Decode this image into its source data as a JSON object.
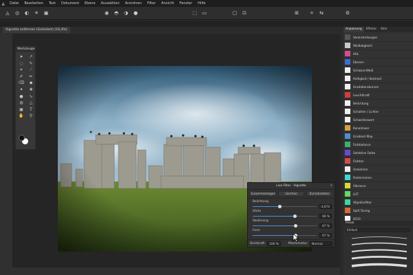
{
  "menu": [
    "Datei",
    "Bearbeiten",
    "Text",
    "Dokument",
    "Ebene",
    "Auswählen",
    "Anordnen",
    "Filter",
    "Ansicht",
    "Fenster",
    "Hilfe"
  ],
  "document": {
    "tab": "Vignette entfernen (Geändert) (16,4%)"
  },
  "tools": {
    "title": "Werkzeuge",
    "icons": [
      "move-tool-icon",
      "view-tool-icon",
      "lasso-icon",
      "crop-icon",
      "brush-icon",
      "picker-icon",
      "paint-icon",
      "erase-icon",
      "clone-icon",
      "healing-icon",
      "dodge-icon",
      "smudge-icon",
      "blur-icon",
      "sharpen-icon",
      "pen-icon",
      "shape-icon",
      "text-icon",
      "gradient-icon",
      "hand-icon",
      "zoom-icon"
    ]
  },
  "vignette": {
    "title": "Live-Filter - Vignette",
    "buttons": [
      "Zusammenlegen",
      "Löschen",
      "Zurücksetzen"
    ],
    "rows": [
      {
        "label": "Belichtung",
        "value": "-3,674",
        "pos": 0.43
      },
      {
        "label": "Härte",
        "value": "66 %",
        "pos": 0.66
      },
      {
        "label": "Skalierung",
        "value": "67 %",
        "pos": 0.67
      },
      {
        "label": "Form",
        "value": "67 %",
        "pos": 0.67
      }
    ],
    "opacity_label": "Deckkraft:",
    "opacity_value": "100 %",
    "blend_label": "Mischmodus:",
    "blend_value": "Normal"
  },
  "panel": {
    "tabs": [
      "Anpassung",
      "Effekte",
      "Stile"
    ],
    "items": [
      {
        "label": "Voreinstellungen",
        "color": "#555555"
      },
      {
        "label": "Weißabgleich",
        "color": "#c9c9c9"
      },
      {
        "label": "HSL",
        "color": "#d84b8f"
      },
      {
        "label": "Ebenen",
        "color": "#3c6fd1"
      },
      {
        "label": "Schwarz-Weiß",
        "color": "#f0f0f0"
      },
      {
        "label": "Helligkeit / Kontrast",
        "color": "#f0f0f0"
      },
      {
        "label": "Gradationskurven",
        "color": "#f0f0f0"
      },
      {
        "label": "Leuchtkraft",
        "color": "#d83b3b"
      },
      {
        "label": "Belichtung",
        "color": "#f0f0f0"
      },
      {
        "label": "Schatten / Lichter",
        "color": "#f0f0f0"
      },
      {
        "label": "Schwellenwert",
        "color": "#f0f0f0"
      },
      {
        "label": "Kanalmixer",
        "color": "#d8a23b"
      },
      {
        "label": "Gradient Map",
        "color": "#4a8fd8"
      },
      {
        "label": "Farbbalance",
        "color": "#3bb36a"
      },
      {
        "label": "Selektive Farbe",
        "color": "#6a4ad8"
      },
      {
        "label": "Farbton",
        "color": "#d84b4b"
      },
      {
        "label": "Umkehren",
        "color": "#f0f0f0"
      },
      {
        "label": "Posterisieren",
        "color": "#3bd8d8"
      },
      {
        "label": "Vibrance",
        "color": "#d8d83b"
      },
      {
        "label": "LUT",
        "color": "#6ad85e"
      },
      {
        "label": "Objektivfilter",
        "color": "#3bd8a2"
      },
      {
        "label": "Split Toning",
        "color": "#d86a3b"
      },
      {
        "label": "OCIO",
        "color": "#ffffff"
      }
    ],
    "brush_tab": "Pinsel",
    "brush_category": "Einfach"
  }
}
